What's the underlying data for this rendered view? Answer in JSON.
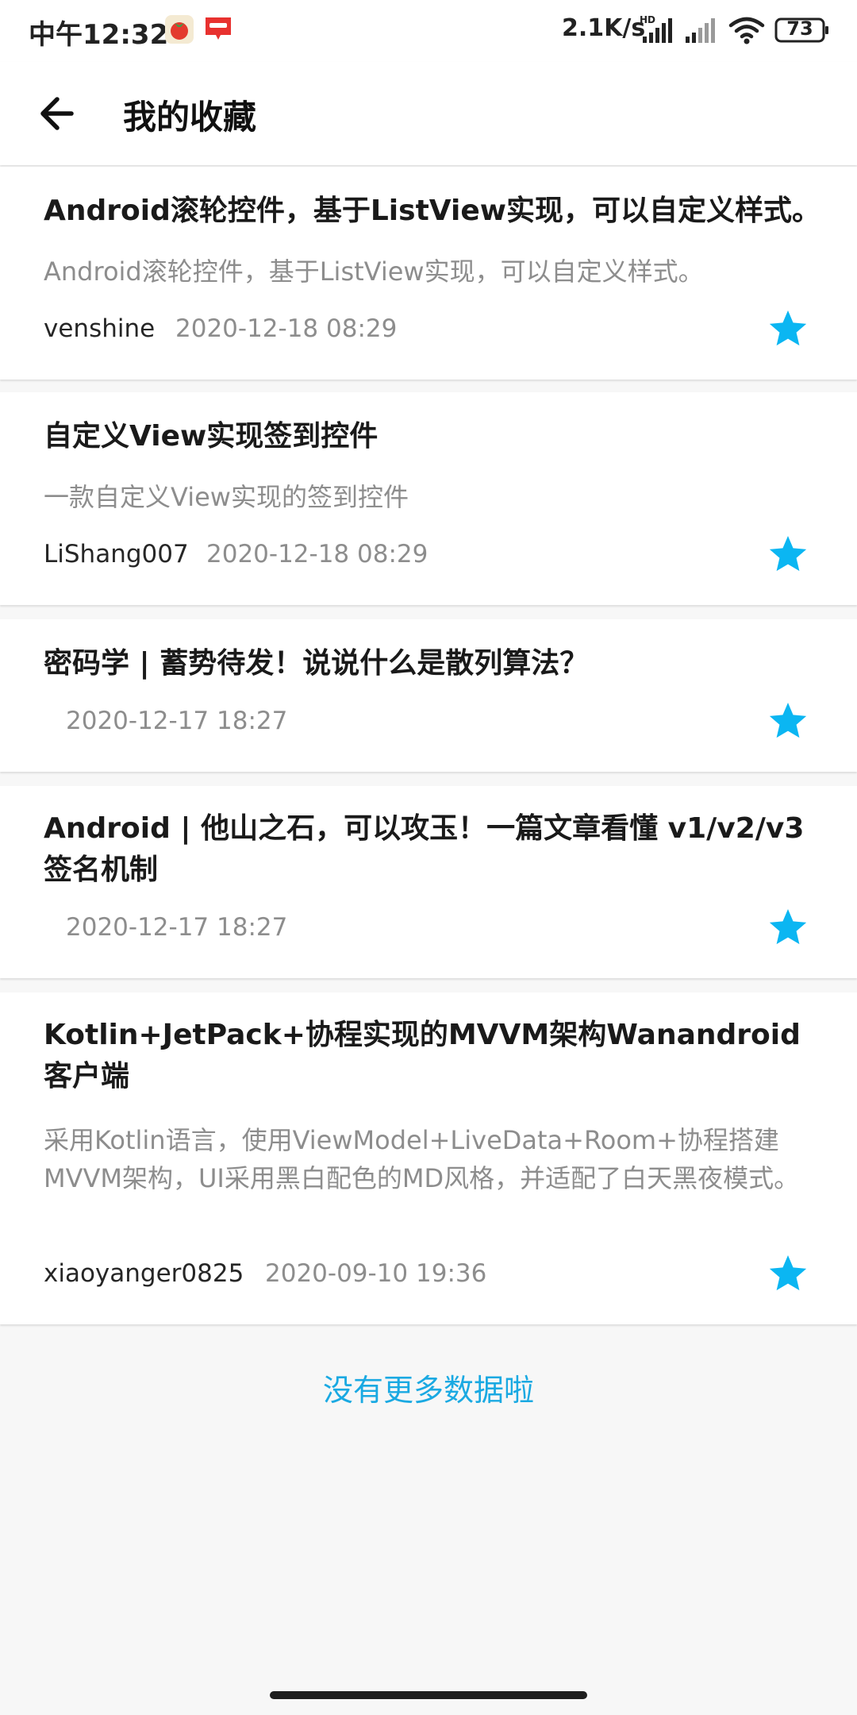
{
  "status_bar": {
    "time": "中午12:32",
    "network_speed": "2.1K/s",
    "signal_label": "HD",
    "battery": "73"
  },
  "app_bar": {
    "title": "我的收藏"
  },
  "articles": [
    {
      "title": "Android滚轮控件，基于ListView实现，可以自定义样式。",
      "desc": "Android滚轮控件，基于ListView实现，可以自定义样式。",
      "author": "venshine",
      "date": "2020-12-18 08:29"
    },
    {
      "title": "自定义View实现签到控件",
      "desc": "一款自定义View实现的签到控件",
      "author": "LiShang007",
      "date": "2020-12-18 08:29"
    },
    {
      "title": "密码学 | 蓄势待发！说说什么是散列算法？",
      "desc": "",
      "author": "",
      "date": "2020-12-17 18:27"
    },
    {
      "title": "Android | 他山之石，可以攻玉！一篇文章看懂 v1/v2/v3 签名机制",
      "desc": "",
      "author": "",
      "date": "2020-12-17 18:27"
    },
    {
      "title": "Kotlin+JetPack+协程实现的MVVM架构Wanandroid客户端",
      "desc": "采用Kotlin语言，使用ViewModel+LiveData+Room+协程搭建MVVM架构，UI采用黑白配色的MD风格，并适配了白天黑夜模式。",
      "author": "xiaoyanger0825",
      "date": "2020-09-10 19:36"
    }
  ],
  "footer": {
    "no_more": "没有更多数据啦"
  },
  "colors": {
    "accent": "#1aa9e2",
    "star": "#0bb6f2",
    "background": "#f7f7f7"
  }
}
